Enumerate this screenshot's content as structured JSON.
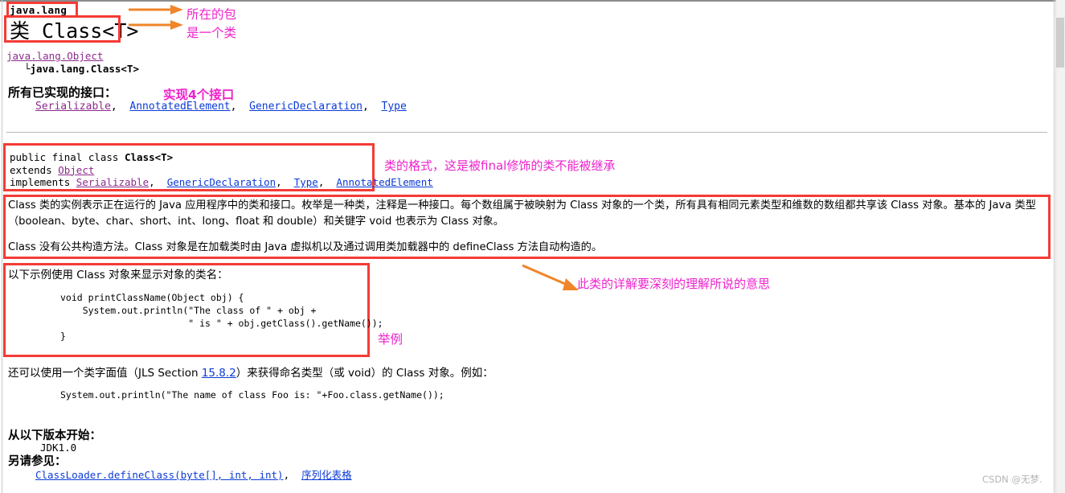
{
  "doc": {
    "package": "java.lang",
    "title": "类 Class<T>",
    "hierarchy_parent": "java.lang.Object",
    "hierarchy_child": "└java.lang.Class<T>",
    "interfaces_label": "所有已实现的接口：",
    "interfaces": [
      "Serializable",
      "AnnotatedElement",
      "GenericDeclaration",
      "Type"
    ],
    "interfaces_line": "Serializable,  AnnotatedElement,  GenericDeclaration,  Type",
    "signature": {
      "line1_plain": "public final class ",
      "line1_bold": "Class<T>",
      "line2_plain": "extends ",
      "line2_link": "Object",
      "line3_plain": "implements ",
      "line3_links": [
        "Serializable",
        "GenericDeclaration",
        "Type",
        "AnnotatedElement"
      ]
    },
    "description": {
      "para1": "Class 类的实例表示正在运行的 Java 应用程序中的类和接口。枚举是一种类，注释是一种接口。每个数组属于被映射为 Class 对象的一个类，所有具有相同元素类型和维数的数组都共享该 Class 对象。基本的 Java 类型（boolean、byte、char、short、int、long、float 和 double）和关键字 void 也表示为 Class 对象。",
      "para2": "Class 没有公共构造方法。Class 对象是在加载类时由 Java 虚拟机以及通过调用类加载器中的 defineClass 方法自动构造的。"
    },
    "example": {
      "intro": "以下示例使用 Class 对象来显示对象的类名：",
      "code": "void printClassName(Object obj) {\n    System.out.println(\"The class of \" + obj +\n                       \" is \" + obj.getClass().getName());\n}"
    },
    "after_example": {
      "text_before_link": "还可以使用一个类字面值（JLS Section ",
      "link": "15.8.2",
      "text_after_link": "）来获得命名类型（或 void）的 Class 对象。例如：",
      "code": "System.out.println(\"The name of class Foo is: \"+Foo.class.getName());"
    },
    "since": {
      "label": "从以下版本开始：",
      "value": "JDK1.0"
    },
    "see_also": {
      "label": "另请参见：",
      "links": [
        "ClassLoader.defineClass(byte[], int, int)",
        "序列化表格"
      ],
      "line": "ClassLoader.defineClass(byte[], int, int),  序列化表格"
    }
  },
  "annotations": {
    "pkg_note_line1": "所在的包",
    "pkg_note_line2": "是一个类",
    "interfaces_note": "实现4个接口",
    "signature_note": "类的格式，这是被final修饰的类不能被继承",
    "description_note": "此类的详解要深刻的理解所说的意思",
    "example_note": "举例"
  },
  "watermark": "CSDN @无梦.",
  "colors": {
    "annotation": "#ee22cc",
    "highlight_box": "#f53b35",
    "arrow": "#f0852a",
    "link": "#0b3bd6",
    "link_visited": "#8b2b8b",
    "watermark": "#b5b5b5"
  }
}
